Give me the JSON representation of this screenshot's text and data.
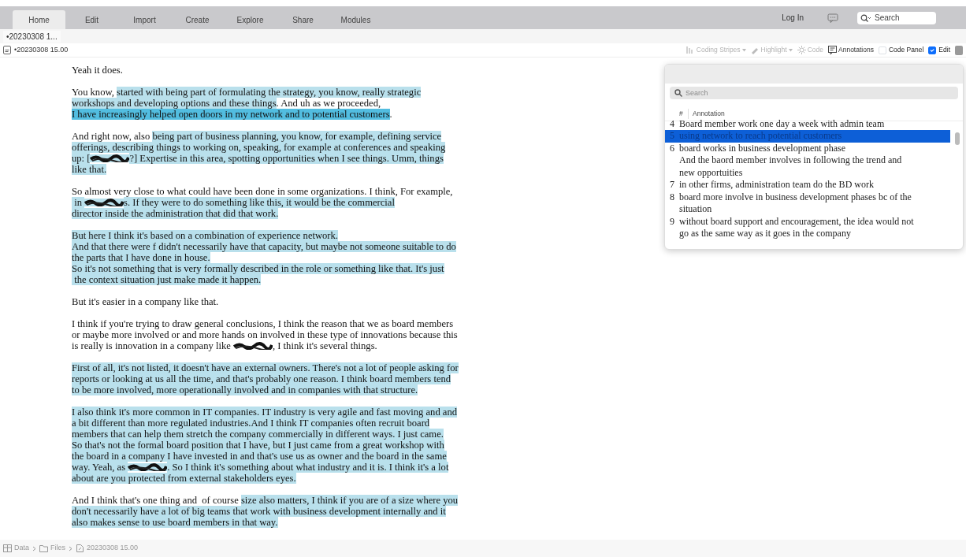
{
  "menu": {
    "tabs": [
      {
        "label": "Home",
        "selected": true
      },
      {
        "label": "Edit",
        "selected": false
      },
      {
        "label": "Import",
        "selected": false
      },
      {
        "label": "Create",
        "selected": false
      },
      {
        "label": "Explore",
        "selected": false
      },
      {
        "label": "Share",
        "selected": false
      },
      {
        "label": "Modules",
        "selected": false
      }
    ],
    "login": "Log In",
    "search": {
      "placeholder": "Search"
    }
  },
  "document_tab": "•20230308 1...",
  "document_title": "•20230308 15.00",
  "toolbar": [
    {
      "kind": "dropdown",
      "label": "Coding Stripes",
      "disabled": true
    },
    {
      "kind": "dropdown",
      "label": "Highlight",
      "disabled": true
    },
    {
      "kind": "button",
      "label": "Code",
      "disabled": true
    },
    {
      "kind": "button",
      "label": "Annotations",
      "disabled": false
    },
    {
      "kind": "checkbox",
      "label": "Code Panel",
      "checked": false
    },
    {
      "kind": "checkbox",
      "label": "Edit",
      "checked": true
    }
  ],
  "transcript": [
    {
      "lines": [
        [
          {
            "kind": "text",
            "text": "Yeah it does.",
            "highlighted": false
          }
        ]
      ]
    },
    {
      "lines": [
        [
          {
            "kind": "text",
            "text": "You know, ",
            "highlighted": false
          },
          {
            "kind": "text",
            "text": "started with being part of formulating the strategy, you know, really strategic",
            "highlighted": true,
            "selected": false
          }
        ],
        [
          {
            "kind": "text",
            "text": "workshops and developing options and these things",
            "highlighted": true,
            "selected": false
          },
          {
            "kind": "text",
            "text": ". And uh as we proceeded,",
            "highlighted": false
          }
        ],
        [
          {
            "kind": "text",
            "text": "I have increasingly helped open doors in my network and to potential customers",
            "highlighted": true,
            "selected": true
          },
          {
            "kind": "text",
            "text": ".",
            "highlighted": false
          }
        ]
      ]
    },
    {
      "lines": [
        [
          {
            "kind": "text",
            "text": "And right now, also ",
            "highlighted": false
          },
          {
            "kind": "text",
            "text": "being part of business planning, you know, for example, defining service",
            "highlighted": true,
            "selected": false
          }
        ],
        [
          {
            "kind": "text",
            "text": "offerings, describing things to working on, speaking, for example at conferences and speaking",
            "highlighted": true,
            "selected": false
          }
        ],
        [
          {
            "kind": "text",
            "text": "up: [",
            "highlighted": true,
            "selected": false
          },
          {
            "kind": "redaction",
            "highlighted": true,
            "selected": false
          },
          {
            "kind": "text",
            "text": "?] Expertise in this area, spotting opportunities when I see things. Umm, things",
            "highlighted": true,
            "selected": false
          }
        ],
        [
          {
            "kind": "text",
            "text": "like that.",
            "highlighted": true,
            "selected": false
          }
        ]
      ]
    },
    {
      "lines": [
        [
          {
            "kind": "text",
            "text": "So almost very close to what could have been done in some organizations. I think, For example,",
            "highlighted": false
          }
        ],
        [
          {
            "kind": "text",
            "text": " in ",
            "highlighted": true,
            "selected": false
          },
          {
            "kind": "redaction",
            "highlighted": true,
            "selected": false
          },
          {
            "kind": "text",
            "text": "s. If they were to do something like this, it would be the commercial",
            "highlighted": true,
            "selected": false
          }
        ],
        [
          {
            "kind": "text",
            "text": "director inside the administration that did that work.",
            "highlighted": true,
            "selected": false
          }
        ]
      ]
    },
    {
      "lines": [
        [
          {
            "kind": "text",
            "text": "But here I think it's based on a combination of experience network.",
            "highlighted": true,
            "selected": false
          }
        ],
        [
          {
            "kind": "text",
            "text": "And that there were f didn't necessarily have that capacity, but maybe not someone suitable to do",
            "highlighted": true,
            "selected": false
          }
        ],
        [
          {
            "kind": "text",
            "text": "the parts that I have done in house.",
            "highlighted": true,
            "selected": false
          }
        ],
        [
          {
            "kind": "text",
            "text": "So it's not something that is very formally described in the role or something like that. It's just",
            "highlighted": true,
            "selected": false
          }
        ],
        [
          {
            "kind": "text",
            "text": " the context situation just make made it happen.",
            "highlighted": true,
            "selected": false
          }
        ]
      ]
    },
    {
      "lines": [
        [
          {
            "kind": "text",
            "text": "But it's easier in a company like that.",
            "highlighted": false
          }
        ]
      ]
    },
    {
      "lines": [
        [
          {
            "kind": "text",
            "text": "I think if you're trying to draw general conclusions, I think the reason that we as board members",
            "highlighted": false
          }
        ],
        [
          {
            "kind": "text",
            "text": "or maybe more involved or and more hands on involved in these type of innovations because this",
            "highlighted": false
          }
        ],
        [
          {
            "kind": "text",
            "text": "is really is innovation in a company like ",
            "highlighted": false
          },
          {
            "kind": "redaction",
            "highlighted": false
          },
          {
            "kind": "text",
            "text": ", I think it's several things.",
            "highlighted": false
          }
        ]
      ]
    },
    {
      "lines": [
        [
          {
            "kind": "text",
            "text": "First of all, it's not listed, it doesn't have an external owners. There's not a lot of people asking for",
            "highlighted": true,
            "selected": false
          }
        ],
        [
          {
            "kind": "text",
            "text": "reports or looking at us all the time, and that's probably one reason. I think board members tend",
            "highlighted": true,
            "selected": false
          }
        ],
        [
          {
            "kind": "text",
            "text": "to be more involved, more operationally involved and in companies with that structure.",
            "highlighted": true,
            "selected": false
          }
        ]
      ]
    },
    {
      "lines": [
        [
          {
            "kind": "text",
            "text": "I also think it's more common in IT companies. IT industry is very agile and fast moving and and",
            "highlighted": true,
            "selected": false
          }
        ],
        [
          {
            "kind": "text",
            "text": "a bit different than more regulated industries.And I think IT companies often recruit board",
            "highlighted": true,
            "selected": false
          }
        ],
        [
          {
            "kind": "text",
            "text": "members that can help them stretch the company commercially in different ways. I just came.",
            "highlighted": true,
            "selected": false
          }
        ],
        [
          {
            "kind": "text",
            "text": "So that's not the formal board position that I have, but I just came from a great workshop with",
            "highlighted": true,
            "selected": false
          }
        ],
        [
          {
            "kind": "text",
            "text": "the board in a company I have invested in and that's use us as owner and the board in the same",
            "highlighted": true,
            "selected": false
          }
        ],
        [
          {
            "kind": "text",
            "text": "way. Yeah, as ",
            "highlighted": true,
            "selected": false
          },
          {
            "kind": "redaction",
            "highlighted": true,
            "selected": false
          },
          {
            "kind": "text",
            "text": ". So I think it's something about what industry and it is. I think it's a lot",
            "highlighted": true,
            "selected": false
          }
        ],
        [
          {
            "kind": "text",
            "text": "about are you protected from external stakeholders eyes.",
            "highlighted": true,
            "selected": false
          }
        ]
      ]
    },
    {
      "lines": [
        [
          {
            "kind": "text",
            "text": "And I think that's one thing and  of course ",
            "highlighted": false
          },
          {
            "kind": "text",
            "text": "size also matters, I think if you are of a size where you",
            "highlighted": true,
            "selected": false
          }
        ],
        [
          {
            "kind": "text",
            "text": "don't necessarily have a lot of big teams that work with business development internally and it",
            "highlighted": true,
            "selected": false
          }
        ],
        [
          {
            "kind": "text",
            "text": "also makes sense to use board members in that way.",
            "highlighted": true,
            "selected": false
          }
        ]
      ]
    }
  ],
  "annotations": {
    "search": {
      "placeholder": "Search"
    },
    "columns": [
      "#",
      "Annotation"
    ],
    "rows": [
      {
        "number": "4",
        "text": "Board member work one day a week with admin team",
        "selected": false
      },
      {
        "number": "5",
        "text": "using network to reach potential customers",
        "selected": true
      },
      {
        "number": "6",
        "text": "board works in business development phase\nAnd the baord member involves in following the trend and new opportuities",
        "selected": false
      },
      {
        "number": "7",
        "text": "in other firms, administration team do the BD work",
        "selected": false
      },
      {
        "number": "8",
        "text": "board more involve in business development phases bc of the situation",
        "selected": false
      },
      {
        "number": "9",
        "text": "without board support and encouragement, the idea would not go as the same way as it goes in the company",
        "selected": false
      }
    ]
  },
  "breadcrumb": [
    {
      "kind": "database",
      "label": "Data"
    },
    {
      "kind": "folder",
      "label": "Files"
    },
    {
      "kind": "file",
      "label": "20230308 15.00"
    }
  ]
}
